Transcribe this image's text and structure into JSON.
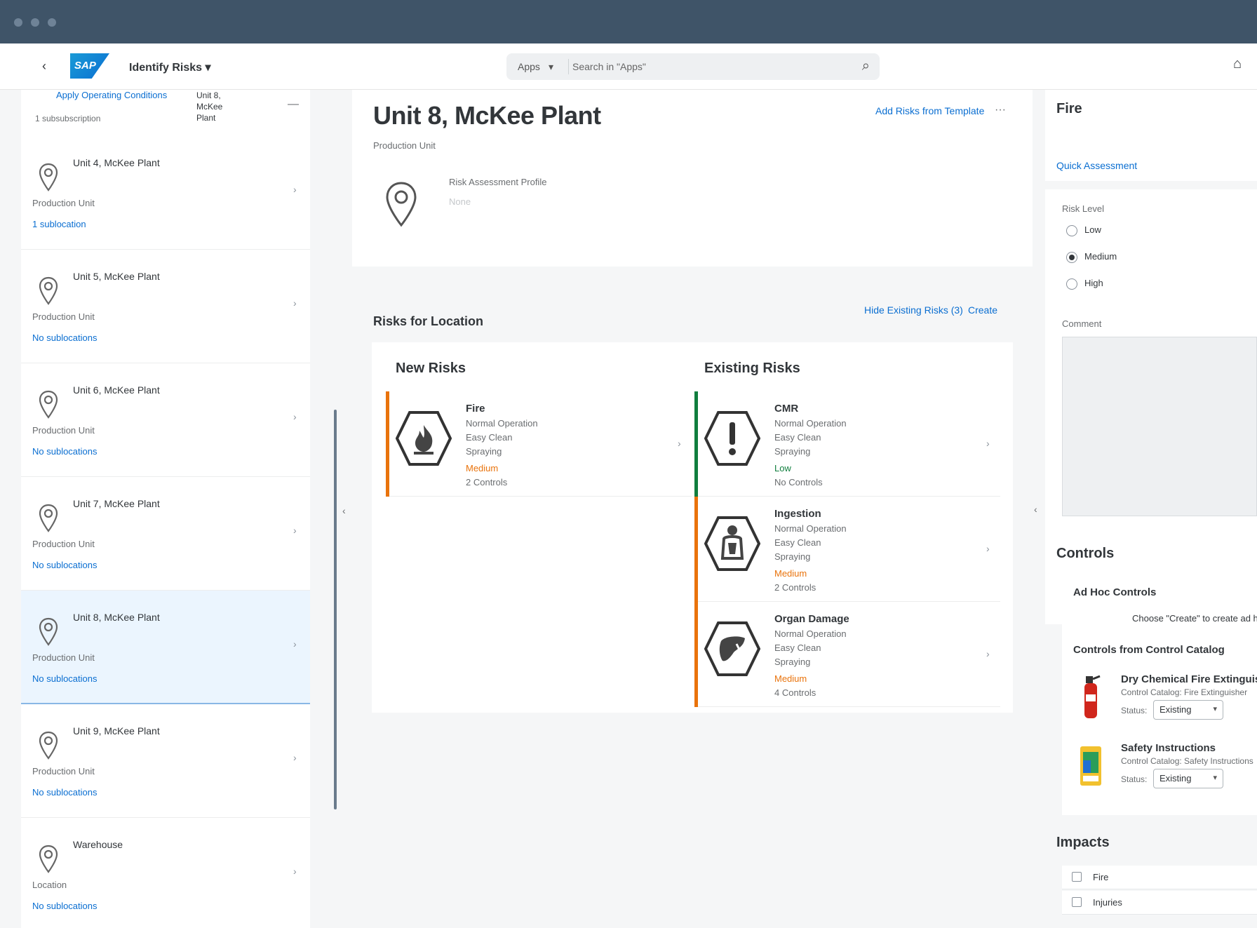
{
  "shell": {
    "app_title": "Identify Risks ▾",
    "search_scope": "Apps",
    "search_placeholder": "Search in \"Apps\"",
    "logo_text": "SAP"
  },
  "left_panel": {
    "top_link": "Apply Operating Conditions",
    "top_text": "Unit 8, McKee Plant",
    "top_sub": "1 subsubscription",
    "items": [
      {
        "name": "Unit 4, McKee Plant",
        "type": "Production Unit",
        "sub": "1 sublocation"
      },
      {
        "name": "Unit 5, McKee Plant",
        "type": "Production Unit",
        "sub": "No sublocations"
      },
      {
        "name": "Unit 6, McKee Plant",
        "type": "Production Unit",
        "sub": "No sublocations"
      },
      {
        "name": "Unit 7, McKee Plant",
        "type": "Production Unit",
        "sub": "No sublocations"
      },
      {
        "name": "Unit 8, McKee Plant",
        "type": "Production Unit",
        "sub": "No sublocations"
      },
      {
        "name": "Unit 9, McKee Plant",
        "type": "Production Unit",
        "sub": "No sublocations"
      },
      {
        "name": "Warehouse",
        "type": "Location",
        "sub": "No sublocations"
      }
    ]
  },
  "header": {
    "title": "Unit 8, McKee Plant",
    "subtitle": "Production Unit",
    "add_template": "Add Risks from Template",
    "more": "···",
    "profile_label": "Risk Assessment Profile",
    "profile_value": "None"
  },
  "risks": {
    "title": "Risks for Location",
    "hide_link": "Hide Existing Risks (3)",
    "create_link": "Create",
    "new_title": "New Risks",
    "existing_title": "Existing Risks",
    "new": [
      {
        "name": "Fire",
        "lines": [
          "Normal Operation",
          "Easy Clean",
          "Spraying"
        ],
        "level": "Medium",
        "controls": "2 Controls",
        "icon": "flammable-icon"
      }
    ],
    "existing": [
      {
        "name": "CMR",
        "lines": [
          "Normal Operation",
          "Easy Clean",
          "Spraying"
        ],
        "level": "Low",
        "controls": "No Controls",
        "icon": "exclamation-icon"
      },
      {
        "name": "Ingestion",
        "lines": [
          "Normal Operation",
          "Easy Clean",
          "Spraying"
        ],
        "level": "Medium",
        "controls": "2 Controls",
        "icon": "health-hazard-icon"
      },
      {
        "name": "Organ Damage",
        "lines": [
          "Normal Operation",
          "Easy Clean",
          "Spraying"
        ],
        "level": "Medium",
        "controls": "4 Controls",
        "icon": "organ-damage-icon"
      }
    ]
  },
  "detail": {
    "title": "Fire",
    "quick_assessment": "Quick Assessment",
    "risk_level_label": "Risk Level",
    "options": [
      "Low",
      "Medium",
      "High"
    ],
    "selected_option": "Medium",
    "comment_label": "Comment",
    "controls_title": "Controls",
    "adhoc_title": "Ad Hoc Controls",
    "adhoc_hint": "Choose \"Create\" to create ad hoc",
    "catalog_title": "Controls from Control Catalog",
    "catalog": [
      {
        "name": "Dry Chemical Fire Extinguisher",
        "category": "Control Catalog: Fire Extinguisher",
        "status_label": "Status:",
        "status": "Existing"
      },
      {
        "name": "Safety Instructions",
        "category": "Control Catalog: Safety Instructions",
        "status_label": "Status:",
        "status": "Existing"
      }
    ],
    "impacts_title": "Impacts",
    "impacts": [
      "Fire",
      "Injuries"
    ]
  },
  "colors": {
    "brand": "#0a6ed1",
    "medium": "#e9730c",
    "low": "#107e3e",
    "shell_dark": "#3f5468"
  }
}
